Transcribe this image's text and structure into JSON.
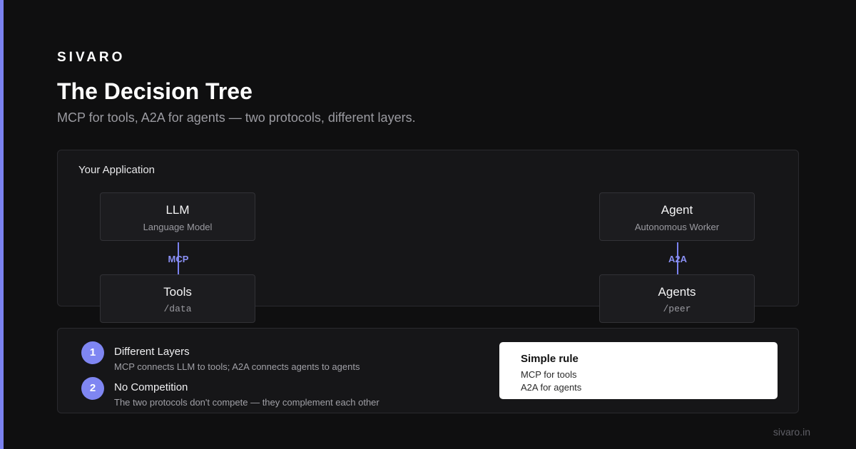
{
  "brand": "SIVARO",
  "title": "The Decision Tree",
  "subtitle": "MCP for tools, A2A for agents — two protocols, different layers.",
  "diagram": {
    "container_label": "Your Application",
    "left": {
      "top_node": {
        "name": "LLM",
        "sub": "Language Model"
      },
      "connector": "MCP",
      "bottom_node": {
        "name": "Tools",
        "sub": "/data"
      }
    },
    "right": {
      "top_node": {
        "name": "Agent",
        "sub": "Autonomous Worker"
      },
      "connector": "A2A",
      "bottom_node": {
        "name": "Agents",
        "sub": "/peer"
      }
    }
  },
  "points": [
    {
      "number": "1",
      "title": "Different Layers",
      "desc": "MCP connects LLM to tools; A2A connects agents to agents"
    },
    {
      "number": "2",
      "title": "No Competition",
      "desc": "The two protocols don't compete — they complement each other"
    }
  ],
  "rule": {
    "title": "Simple rule",
    "lines": [
      "MCP for tools",
      "A2A for agents"
    ]
  },
  "footer": "sivaro.in",
  "colors": {
    "background": "#0f0f10",
    "accent": "#7b82f0",
    "panel": "#161618",
    "card": "#ffffff"
  }
}
